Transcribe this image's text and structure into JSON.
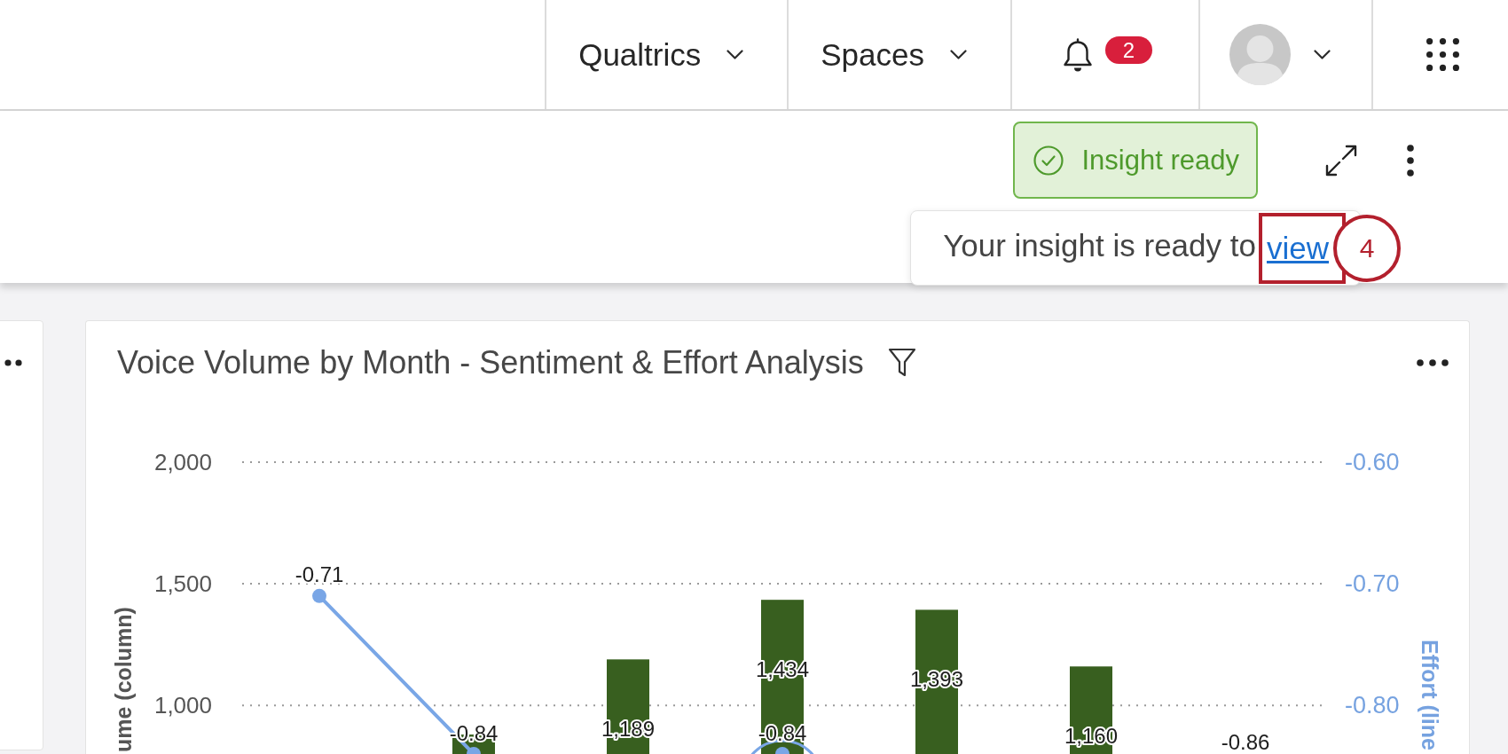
{
  "top_nav": {
    "menus": [
      {
        "label": "Qualtrics"
      },
      {
        "label": "Spaces"
      }
    ],
    "notifications": {
      "count": "2"
    }
  },
  "toolbar": {
    "status_button": {
      "label": "Insight ready"
    },
    "popup": {
      "message": "Your insight is ready to",
      "link": "view",
      "callout_step": "4"
    }
  },
  "chart_card": {
    "title": "Voice Volume by Month - Sentiment & Effort Analysis",
    "highlighted_points": [
      false,
      false,
      false,
      true,
      false,
      false,
      false
    ],
    "chart_data": {
      "type": "bar",
      "ylabel": "ume (column)",
      "y2label": "Effort (line",
      "ylim": [
        800,
        2000
      ],
      "y2lim": [
        -0.84,
        -0.6
      ],
      "yticks": [
        {
          "value": 1000,
          "label": "1,000"
        },
        {
          "value": 1500,
          "label": "1,500"
        },
        {
          "value": 2000,
          "label": "2,000"
        }
      ],
      "y2ticks": [
        {
          "value": -0.8,
          "label": "-0.80"
        },
        {
          "value": -0.7,
          "label": "-0.70"
        },
        {
          "value": -0.6,
          "label": "-0.60"
        }
      ],
      "series": [
        {
          "color": "#385f1f",
          "values": [
            null,
            880,
            1189,
            1434,
            1393,
            1160,
            null
          ],
          "value_labels": [
            null,
            null,
            "1,189",
            "1,434",
            "1,393",
            "1,160",
            null
          ]
        },
        {
          "type": "line",
          "axis": "y2",
          "marker": true,
          "color": "#79a6e6",
          "values": [
            -0.71,
            -0.84,
            null,
            -0.84,
            null,
            null,
            null
          ],
          "value_labels": [
            "-0.71",
            "-0.84",
            null,
            "-0.84",
            null,
            null,
            "-0.86"
          ]
        }
      ]
    }
  }
}
